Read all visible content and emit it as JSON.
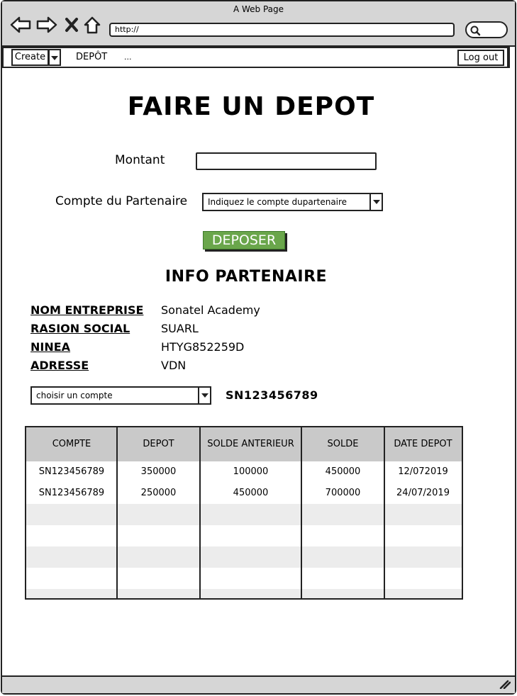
{
  "window": {
    "title": "A Web Page",
    "url": "http://"
  },
  "menu": {
    "create_label": "Create",
    "depot_label": "DEPÔT",
    "more_label": "...",
    "logout_label": "Log out"
  },
  "form": {
    "title": "FAIRE UN DEPOT",
    "amount_label": "Montant",
    "amount_value": "",
    "partner_account_label": "Compte du Partenaire",
    "partner_account_select": "Indiquez le compte dupartenaire",
    "deposit_button": "DEPOSER",
    "accent_color": "#6aa64b"
  },
  "partner_info": {
    "title": "INFO PARTENAIRE",
    "fields": [
      {
        "label": "NOM ENTREPRISE",
        "value": "Sonatel Academy"
      },
      {
        "label": "RASION SOCIAL",
        "value": "SUARL"
      },
      {
        "label": "NINEA",
        "value": "HTYG852259D"
      },
      {
        "label": "ADRESSE",
        "value": "VDN"
      }
    ],
    "account_select": "choisir un compte",
    "selected_account": "SN123456789"
  },
  "table": {
    "headers": [
      "COMPTE",
      "DEPOT",
      "SOLDE ANTERIEUR",
      "SOLDE",
      "DATE DEPOT"
    ],
    "rows": [
      [
        "SN123456789",
        "350000",
        "100000",
        "450000",
        "12/072019"
      ],
      [
        "SN123456789",
        "250000",
        "450000",
        "700000",
        "24/07/2019"
      ],
      [
        "",
        "",
        "",
        "",
        ""
      ],
      [
        "",
        "",
        "",
        "",
        ""
      ],
      [
        "",
        "",
        "",
        "",
        ""
      ],
      [
        "",
        "",
        "",
        "",
        ""
      ]
    ]
  }
}
